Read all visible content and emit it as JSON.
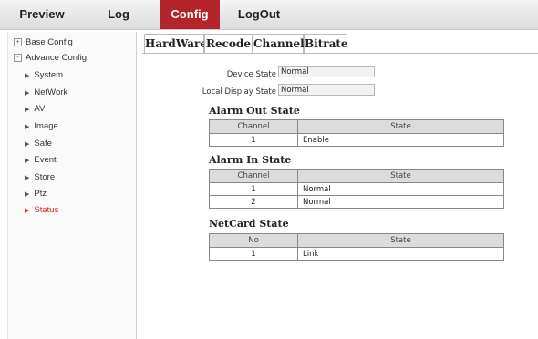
{
  "nav": {
    "items": [
      {
        "label": "Preview"
      },
      {
        "label": "Log"
      },
      {
        "label": "Config"
      },
      {
        "label": "LogOut"
      }
    ],
    "active_color": "#b3252a"
  },
  "sidebar": {
    "groups": [
      {
        "label": "Base Config",
        "toggle": "+"
      },
      {
        "label": "Advance Config",
        "toggle": "-"
      }
    ],
    "items": [
      {
        "label": "System"
      },
      {
        "label": "NetWork"
      },
      {
        "label": "AV"
      },
      {
        "label": "Image"
      },
      {
        "label": "Safe"
      },
      {
        "label": "Event"
      },
      {
        "label": "Store"
      },
      {
        "label": "Ptz"
      },
      {
        "label": "Status"
      }
    ],
    "active_item": "Status",
    "active_color": "#d52b1e"
  },
  "tabs": [
    {
      "label": "HardWare"
    },
    {
      "label": "Recode"
    },
    {
      "label": "Channel"
    },
    {
      "label": "Bitrate"
    }
  ],
  "hardware": {
    "device_state": {
      "label": "Device State",
      "value": "Normal"
    },
    "local_display_state": {
      "label": "Local Display State",
      "value": "Normal"
    },
    "alarm_out": {
      "title": "Alarm Out State",
      "columns": [
        "Channel",
        "State"
      ],
      "rows": [
        [
          "1",
          "Enable"
        ]
      ]
    },
    "alarm_in": {
      "title": "Alarm In State",
      "columns": [
        "Channel",
        "State"
      ],
      "rows": [
        [
          "1",
          "Normal"
        ],
        [
          "2",
          "Normal"
        ]
      ]
    },
    "netcard": {
      "title": "NetCard State",
      "columns": [
        "No",
        "State"
      ],
      "rows": [
        [
          "1",
          "Link"
        ]
      ]
    }
  }
}
